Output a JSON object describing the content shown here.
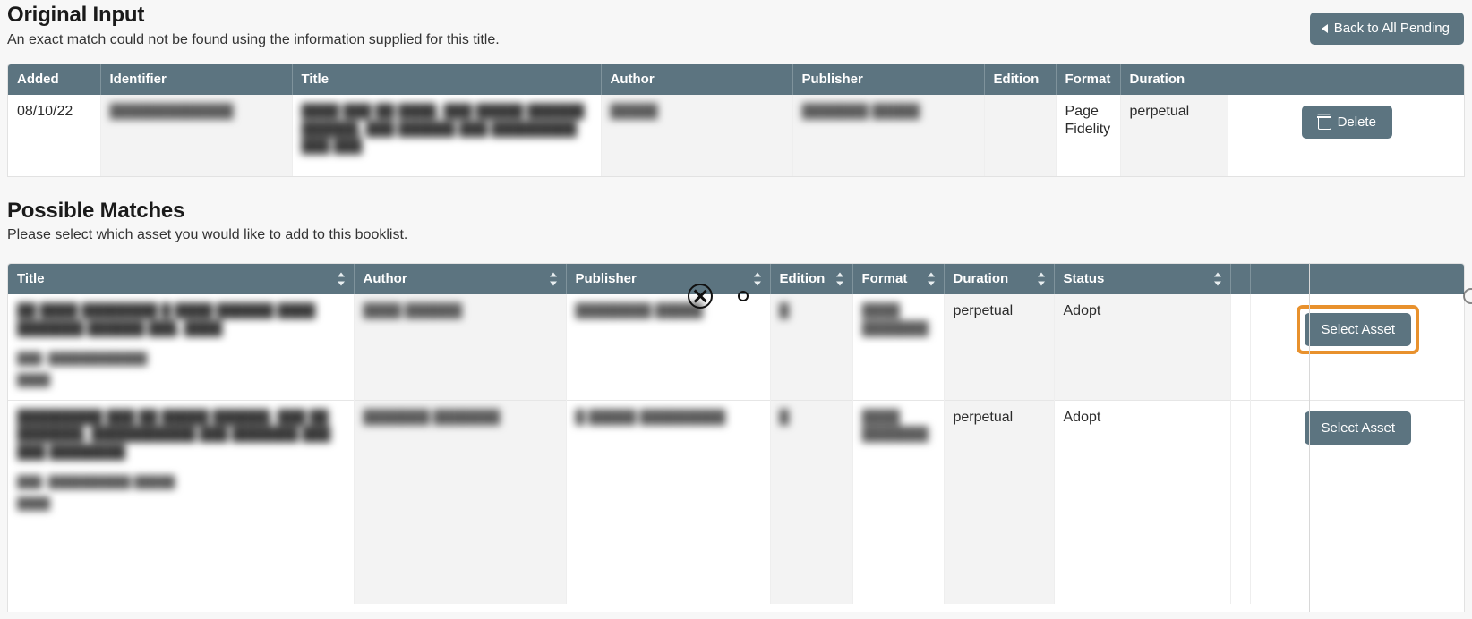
{
  "original": {
    "heading": "Original Input",
    "subheading": "An exact match could not be found using the information supplied for this title.",
    "back_button": "Back to All Pending",
    "columns": [
      "Added",
      "Identifier",
      "Title",
      "Author",
      "Publisher",
      "Edition",
      "Format",
      "Duration",
      ""
    ],
    "rows": [
      {
        "added": "08/10/22",
        "identifier": "█████████████",
        "title": "████ ███ ██ ████, ███ █████ ██████ ██████, ███ ██████ ███ █████████ ███ ███",
        "author": "█████",
        "publisher": "███████ █████",
        "edition": "",
        "format": "Page Fidelity",
        "duration": "perpetual",
        "delete_label": "Delete"
      }
    ]
  },
  "matches": {
    "heading": "Possible Matches",
    "subheading": "Please select which asset you would like to add to this booklist.",
    "columns": [
      {
        "label": "Title",
        "sortable": true
      },
      {
        "label": "Author",
        "sortable": true
      },
      {
        "label": "Publisher",
        "sortable": true
      },
      {
        "label": "Edition",
        "sortable": true
      },
      {
        "label": "Format",
        "sortable": true
      },
      {
        "label": "Duration",
        "sortable": true
      },
      {
        "label": "Status",
        "sortable": true
      },
      {
        "label": "",
        "sortable": false
      },
      {
        "label": "",
        "sortable": false
      }
    ],
    "rows": [
      {
        "title": "██ ████ ████████ █ ████ ██████ ████ ███████ ██████ ███, ████",
        "title_meta1": "███: ████████████",
        "title_meta2": "████",
        "author": "████ ██████",
        "publisher": "████████ █████",
        "edition": "█",
        "format": "████ ███████",
        "duration": "perpetual",
        "status": "Adopt",
        "select_label": "Select Asset",
        "highlighted": true
      },
      {
        "title": "█████████ ███ ██ █████ ██████, ███ ██ ███████, ███████████ ███ ███████ ███ ███ ████████",
        "title_meta1": "███: ██████████ █████",
        "title_meta2": "████",
        "author": "███████ ███████",
        "publisher": "█ █████ █████████",
        "edition": "█",
        "format": "████ ███████",
        "duration": "perpetual",
        "status": "Adopt",
        "select_label": "Select Asset",
        "highlighted": false
      }
    ]
  },
  "colors": {
    "header_bg": "#5c7480",
    "button_bg": "#5c7480",
    "highlight": "#e8912d",
    "page_bg": "#f7f7f7",
    "shade_cell": "#f3f3f3"
  },
  "annotations": {
    "click_marker": "x-circle-marker",
    "dot_marker": "small-circle-marker"
  }
}
